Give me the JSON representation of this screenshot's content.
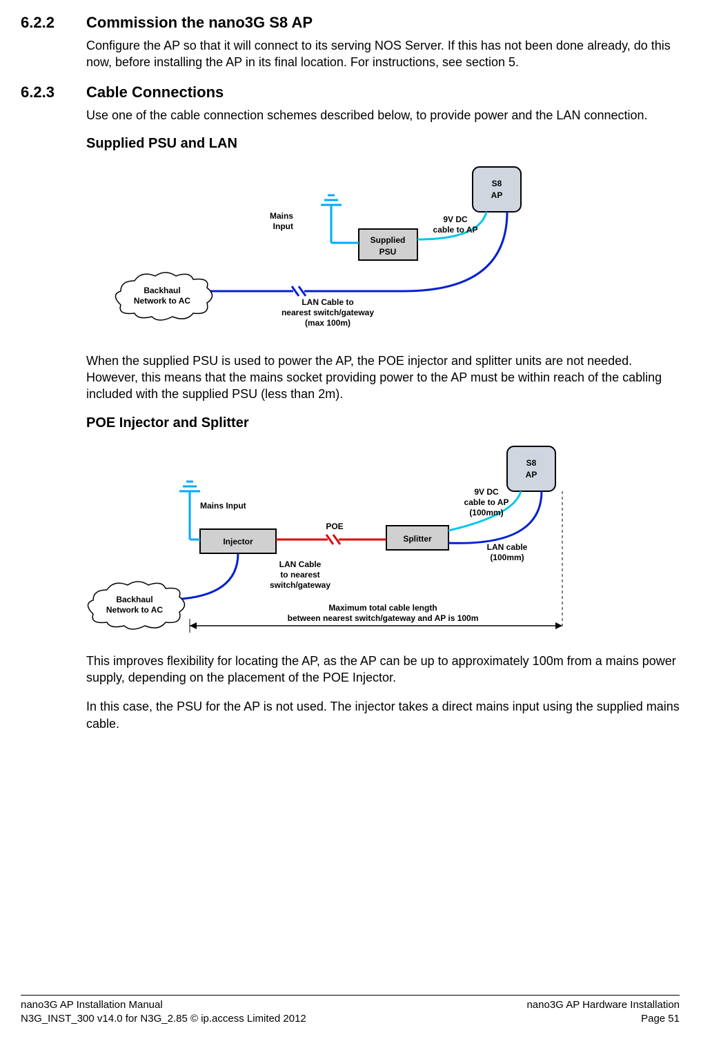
{
  "s622": {
    "num": "6.2.2",
    "title": "Commission the nano3G S8 AP",
    "para": "Configure the AP so that it will connect to its serving NOS Server. If this has not been done already, do this now, before installing the AP in its final location. For instructions, see section 5."
  },
  "s623": {
    "num": "6.2.3",
    "title": "Cable Connections",
    "para": "Use one of the cable connection schemes described below, to provide power and the LAN connection."
  },
  "psu": {
    "title": "Supplied PSU and LAN",
    "diagram": {
      "s8": "S8",
      "ap": "AP",
      "mains": "Mains",
      "input": "Input",
      "supplied": "Supplied",
      "psu": "PSU",
      "dc1": "9V DC",
      "dc2": "cable to AP",
      "backhaul1": "Backhaul",
      "backhaul2": "Network to AC",
      "lan1": "LAN Cable to",
      "lan2": "nearest switch/gateway",
      "lan3": "(max 100m)"
    },
    "para": "When the supplied PSU is used to power the AP, the POE injector and splitter units are not needed. However, this means that the mains socket providing power to the AP must be within reach of the cabling included with the supplied PSU (less than 2m)."
  },
  "poe": {
    "title": "POE Injector and Splitter",
    "diagram": {
      "s8": "S8",
      "ap": "AP",
      "mains": "Mains Input",
      "injector": "Injector",
      "splitter": "Splitter",
      "poe": "POE",
      "dc1": "9V DC",
      "dc2": "cable to AP",
      "dc3": "(100mm)",
      "lanc1": "LAN cable",
      "lanc2": "(100mm)",
      "lanto1": "LAN Cable",
      "lanto2": "to nearest",
      "lanto3": "switch/gateway",
      "backhaul1": "Backhaul",
      "backhaul2": "Network to AC",
      "max1": "Maximum total cable length",
      "max2": "between nearest switch/gateway and AP is 100m"
    },
    "para1": "This improves flexibility for locating the AP, as the AP can be up to approximately 100m from a mains power supply, depending on the placement of the POE Injector.",
    "para2": "In this case, the PSU for the AP is not used. The injector takes a direct mains input using the supplied mains cable."
  },
  "footer": {
    "left1": "nano3G AP Installation Manual",
    "left2": "N3G_INST_300 v14.0 for N3G_2.85 © ip.access Limited 2012",
    "right1": "nano3G AP Hardware Installation",
    "right2": "Page 51"
  }
}
